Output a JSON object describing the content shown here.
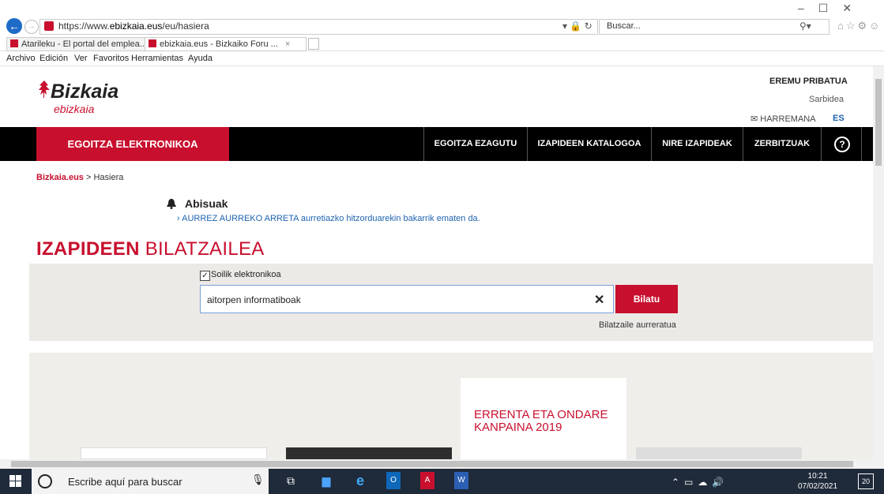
{
  "browser": {
    "url_prefix": "https://www.",
    "url_domain": "ebizkaia.eus",
    "url_path": "/eu/hasiera",
    "search_placeholder": "Buscar...",
    "tabs": [
      {
        "label": "Atarileku - El portal del emplea..."
      },
      {
        "label": "ebizkaia.eus - Bizkaiko Foru ..."
      }
    ],
    "tab_close": "×",
    "menu": [
      "Archivo",
      "Edición",
      "Ver",
      "Favoritos",
      "Herramientas",
      "Ayuda"
    ]
  },
  "header": {
    "logo": "Bizkaia",
    "logo_sub": "ebizkaia",
    "private_area": "EREMU PRIBATUA",
    "login": "Sarbidea",
    "contact": "HARREMANA",
    "language": "ES"
  },
  "nav": {
    "brand": "EGOITZA ELEKTRONIKOA",
    "items": [
      "EGOITZA EZAGUTU",
      "IZAPIDEEN KATALOGOA",
      "NIRE IZAPIDEAK",
      "ZERBITZUAK"
    ],
    "help": "?"
  },
  "breadcrumb": {
    "link": "Bizkaia.eus",
    "sep": ">",
    "current": "Hasiera"
  },
  "notices": {
    "title": "Abisuak",
    "item": "AURREZ AURREKO ARRETA aurretiazko hitzorduarekin bakarrik ematen da."
  },
  "search": {
    "heading_bold": "IZAPIDEEN",
    "heading_light": "BILATZAILEA",
    "checkbox_label": "Soilik elektronikoa",
    "query": "aitorpen informatiboak",
    "button": "Bilatu",
    "advanced": "Bilatzaile aurreratua"
  },
  "cards": {
    "center_title": "ERRENTA ETA ONDARE KANPAINA 2019"
  },
  "taskbar": {
    "search_text": "Escribe aquí para buscar",
    "time": "10:21",
    "date": "07/02/2021",
    "notifications": "20"
  },
  "colors": {
    "brand_red": "#c8102e",
    "nav_black": "#000000",
    "link_blue": "#1e63b0"
  }
}
